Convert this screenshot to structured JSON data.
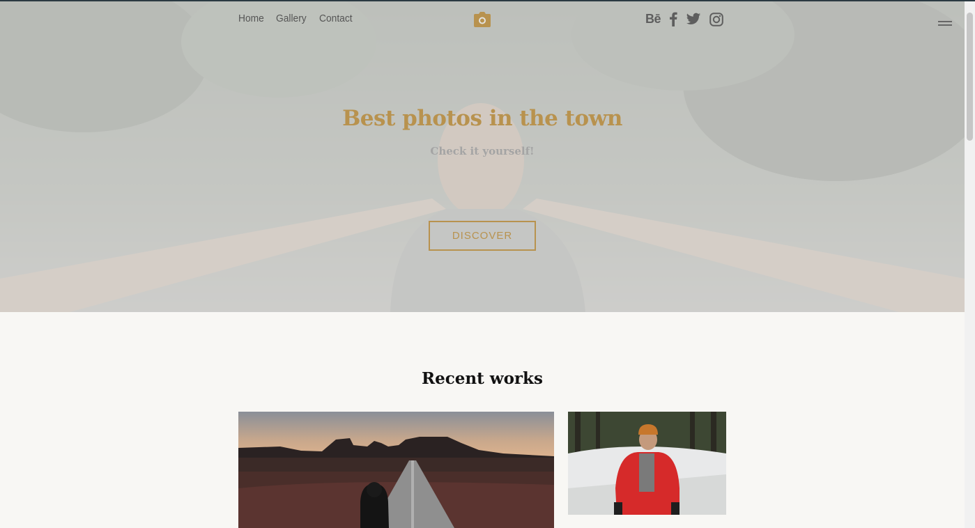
{
  "nav": {
    "items": [
      "Home",
      "Gallery",
      "Contact"
    ]
  },
  "logo": {
    "icon": "camera-icon"
  },
  "social": {
    "items": [
      {
        "icon": "behance-icon",
        "label": "Bē"
      },
      {
        "icon": "facebook-icon"
      },
      {
        "icon": "twitter-icon"
      },
      {
        "icon": "instagram-icon"
      }
    ]
  },
  "menu": {
    "icon": "hamburger-menu-icon"
  },
  "hero": {
    "title": "Best photos in the town",
    "subtitle": "Check it yourself!",
    "button_label": "DISCOVER"
  },
  "recent": {
    "title": "Recent works"
  },
  "colors": {
    "accent": "#b8924e",
    "nav_text": "#555555",
    "background": "#f8f7f4",
    "title_text": "#111111"
  }
}
